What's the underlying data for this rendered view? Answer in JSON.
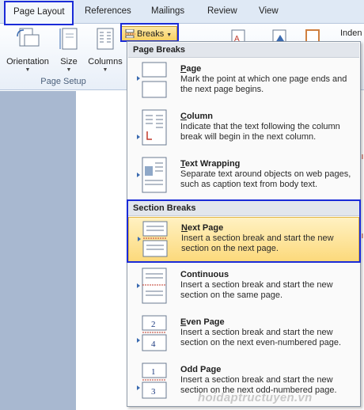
{
  "tabs": [
    {
      "label": "Page Layout",
      "active": true
    },
    {
      "label": "References"
    },
    {
      "label": "Mailings"
    },
    {
      "label": "Review"
    },
    {
      "label": "View"
    }
  ],
  "ribbon": {
    "orientation_label": "Orientation",
    "size_label": "Size",
    "columns_label": "Columns",
    "group_label": "Page Setup",
    "breaks_label": "Breaks",
    "indent_label": "Inden"
  },
  "menu": {
    "page_breaks_header": "Page Breaks",
    "section_breaks_header": "Section Breaks",
    "items": [
      {
        "key": "P",
        "rest": "age",
        "description": "Mark the point at which one page ends and the next page begins.",
        "icon": "page-break-icon"
      },
      {
        "key": "C",
        "rest": "olumn",
        "description": "Indicate that the text following the column break will begin in the next column.",
        "icon": "column-break-icon"
      },
      {
        "key": "T",
        "rest": "ext Wrapping",
        "description": "Separate text around objects on web pages, such as caption text from body text.",
        "icon": "text-wrapping-icon"
      },
      {
        "key": "N",
        "rest": "ext Page",
        "description": "Insert a section break and start the new section on the next page.",
        "icon": "next-page-icon",
        "selected": true
      },
      {
        "key": "O",
        "rest": "Continuous",
        "description": "Insert a section break and start the new section on the same page.",
        "icon": "continuous-icon"
      },
      {
        "key": "E",
        "rest": "ven Page",
        "description": "Insert a section break and start the new section on the next even-numbered page.",
        "icon": "even-page-icon"
      },
      {
        "key": "D",
        "rest": "Odd Page",
        "description": "Insert a section break and start the new section on the next odd-numbered page.",
        "icon": "odd-page-icon"
      }
    ]
  },
  "watermark": "hoidaptructuyen.vn",
  "colors": {
    "highlight": "#1a2bd8",
    "selection": "#fcd97a",
    "accent_red": "#c0392b"
  }
}
